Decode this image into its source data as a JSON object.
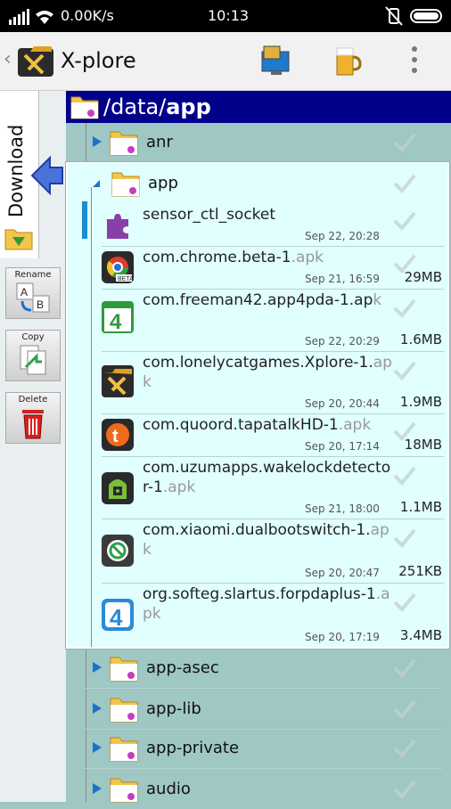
{
  "status": {
    "speed": "0.00K/s",
    "time": "10:13"
  },
  "header": {
    "title": "X-plore"
  },
  "left": {
    "download_label": "Download",
    "tools": [
      {
        "label": "Rename"
      },
      {
        "label": "Copy"
      },
      {
        "label": "Delete"
      }
    ]
  },
  "path": {
    "prefix": "/data/",
    "current": "app"
  },
  "tree": {
    "folder_anr": "anr",
    "folder_app": "app",
    "items": [
      {
        "name": "sensor_ctl_socket",
        "ext": "",
        "date": "Sep 22, 20:28",
        "size": "",
        "icon": "puzzle-icon"
      },
      {
        "name": "com.chrome.beta-1",
        "ext": ".apk",
        "date": "Sep 21, 16:59",
        "size": "29MB",
        "icon": "chrome-beta-icon"
      },
      {
        "name": "com.freeman42.app4pda-1.ap",
        "ext": "k",
        "date": "Sep 22, 20:29",
        "size": "1.6MB",
        "icon": "app4pda-icon"
      },
      {
        "name": "com.lonelycatgames.Xplore-1.",
        "ext": "apk",
        "date": "Sep 20, 20:44",
        "size": "1.9MB",
        "icon": "xplore-icon"
      },
      {
        "name": "com.quoord.tapatalkHD-1",
        "ext": ".apk",
        "date": "Sep 20, 17:14",
        "size": "18MB",
        "icon": "tapatalk-icon"
      },
      {
        "name": "com.uzumapps.wakelockdetector-1",
        "ext": ".apk",
        "date": "Sep 21, 18:00",
        "size": "1.1MB",
        "icon": "wakelock-icon"
      },
      {
        "name": "com.xiaomi.dualbootswitch-1.",
        "ext": "apk",
        "date": "Sep 20, 20:47",
        "size": "251KB",
        "icon": "dualboot-icon"
      },
      {
        "name": "org.softeg.slartus.forpdaplus-1",
        "ext": ".apk",
        "date": "Sep 20, 17:19",
        "size": "3.4MB",
        "icon": "forpda-icon"
      }
    ],
    "folders_after": [
      "app-asec",
      "app-lib",
      "app-private",
      "audio"
    ]
  },
  "colors": {
    "pathbar": "#00008b",
    "accent": "#1a73c8",
    "tree_bg": "#9fc7c3",
    "expanded_bg": "#e0fffe"
  }
}
